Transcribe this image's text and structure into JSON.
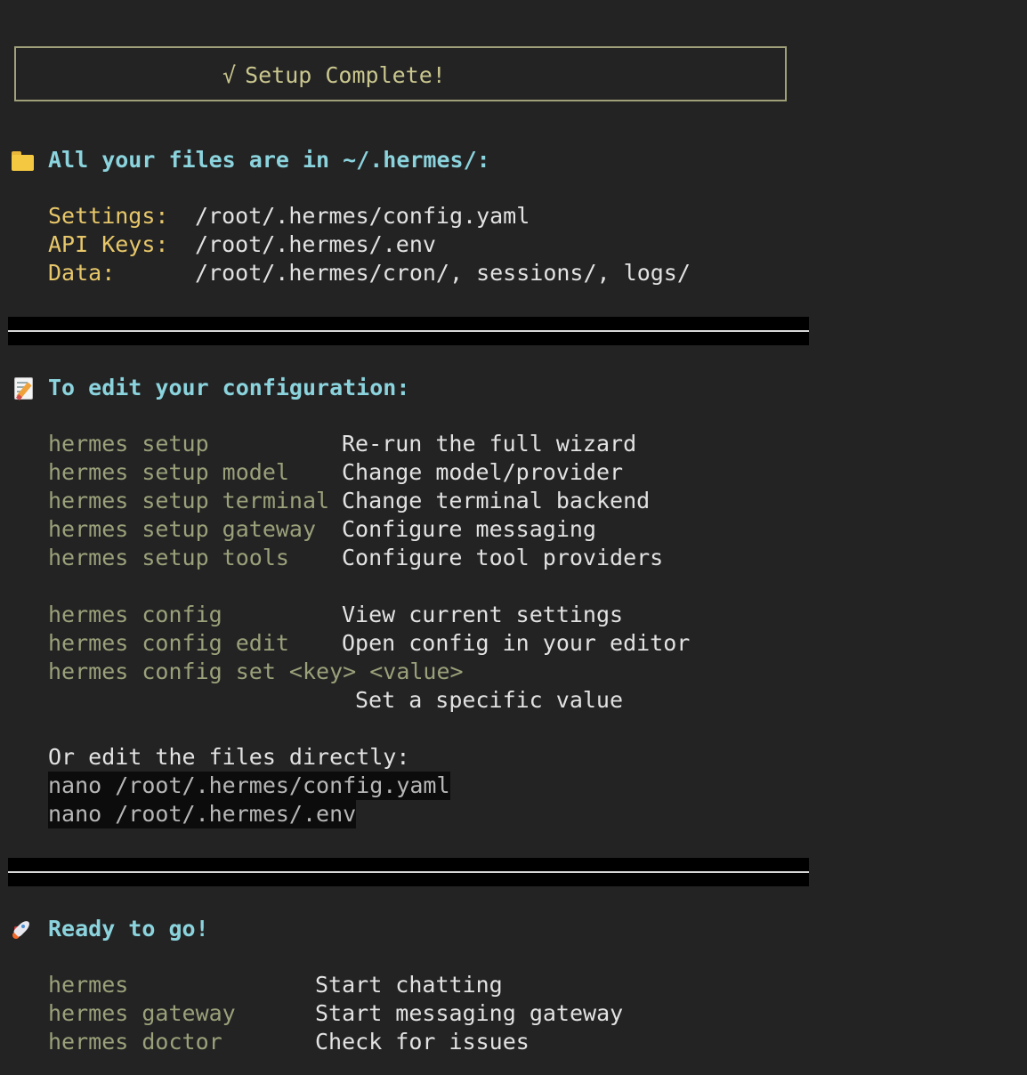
{
  "header": {
    "check_symbol": "√",
    "title": "Setup Complete!"
  },
  "files_section": {
    "icon": "folder-icon",
    "heading": "All your files are in ~/.hermes/:",
    "rows": [
      {
        "label": "Settings:",
        "value": "/root/.hermes/config.yaml"
      },
      {
        "label": "API Keys:",
        "value": "/root/.hermes/.env"
      },
      {
        "label": "Data:",
        "value": "/root/.hermes/cron/, sessions/, logs/"
      }
    ]
  },
  "config_section": {
    "icon": "memo-icon",
    "heading": "To edit your configuration:",
    "setup_commands": [
      {
        "cmd": "hermes setup",
        "desc": "Re-run the full wizard"
      },
      {
        "cmd": "hermes setup model",
        "desc": "Change model/provider"
      },
      {
        "cmd": "hermes setup terminal",
        "desc": "Change terminal backend"
      },
      {
        "cmd": "hermes setup gateway",
        "desc": "Configure messaging"
      },
      {
        "cmd": "hermes setup tools",
        "desc": "Configure tool providers"
      }
    ],
    "config_commands": [
      {
        "cmd": "hermes config",
        "desc": "View current settings"
      },
      {
        "cmd": "hermes config edit",
        "desc": "Open config in your editor"
      }
    ],
    "config_set": {
      "cmd": "hermes config set <key> <value>",
      "desc": "Set a specific value"
    },
    "direct_edit_label": "Or edit the files directly:",
    "direct_edit_commands": [
      "nano /root/.hermes/config.yaml",
      "nano /root/.hermes/.env"
    ]
  },
  "ready_section": {
    "icon": "rocket-icon",
    "heading": "Ready to go!",
    "commands": [
      {
        "cmd": "hermes",
        "desc": "Start chatting"
      },
      {
        "cmd": "hermes gateway",
        "desc": "Start messaging gateway"
      },
      {
        "cmd": "hermes doctor",
        "desc": "Check for issues"
      }
    ]
  }
}
